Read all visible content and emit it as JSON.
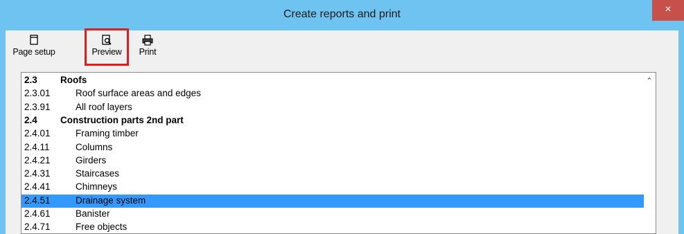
{
  "window": {
    "title": "Create reports and print",
    "close_label": "×"
  },
  "toolbar": {
    "page_setup_label": "Page setup",
    "preview_label": "Preview",
    "print_label": "Print"
  },
  "list": {
    "rows": [
      {
        "code": "2.3",
        "name": "Roofs",
        "section": true
      },
      {
        "code": "2.3.01",
        "name": "Roof surface areas and edges"
      },
      {
        "code": "2.3.91",
        "name": "All roof layers"
      },
      {
        "code": "2.4",
        "name": "Construction parts 2nd part",
        "section": true
      },
      {
        "code": "2.4.01",
        "name": "Framing timber"
      },
      {
        "code": "2.4.11",
        "name": "Columns"
      },
      {
        "code": "2.4.21",
        "name": "Girders"
      },
      {
        "code": "2.4.31",
        "name": "Staircases"
      },
      {
        "code": "2.4.41",
        "name": "Chimneys"
      },
      {
        "code": "2.4.51",
        "name": "Drainage system",
        "selected": true
      },
      {
        "code": "2.4.61",
        "name": "Banister"
      },
      {
        "code": "2.4.71",
        "name": "Free objects"
      }
    ]
  },
  "colors": {
    "titlebar": "#6ec3f0",
    "close": "#c7504b",
    "selection": "#3399ff",
    "highlight_border": "#e21b1b"
  },
  "icons": [
    "page-setup-icon",
    "preview-icon",
    "print-icon",
    "close-icon",
    "scroll-up-icon"
  ]
}
